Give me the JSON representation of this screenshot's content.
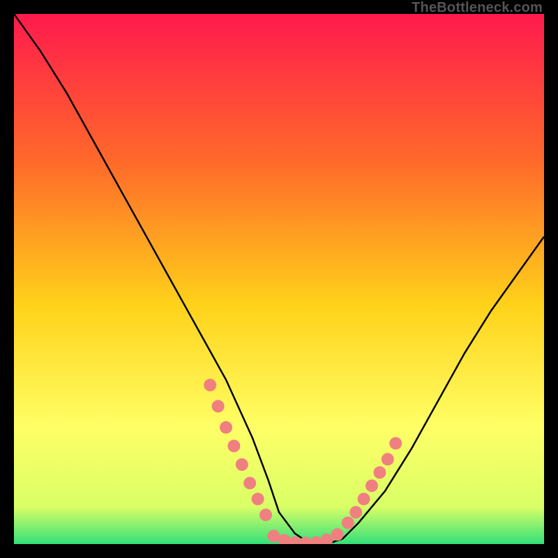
{
  "watermark": "TheBottleneck.com",
  "colors": {
    "frame": "#000000",
    "grad_top": "#ff1a4d",
    "grad_mid1": "#ff6a2a",
    "grad_mid2": "#ffd21a",
    "grad_mid3": "#ffff66",
    "grad_mid4": "#d9ff66",
    "grad_bottom": "#33e07a",
    "curve": "#000000",
    "marker": "#f08080"
  },
  "chart_data": {
    "type": "line",
    "title": "",
    "xlabel": "",
    "ylabel": "",
    "xlim": [
      0,
      100
    ],
    "ylim": [
      0,
      100
    ],
    "series": [
      {
        "name": "bottleneck_curve",
        "x": [
          0,
          5,
          10,
          15,
          20,
          25,
          30,
          35,
          40,
          45,
          48,
          50,
          53,
          56,
          59,
          62,
          65,
          70,
          75,
          80,
          85,
          90,
          95,
          100
        ],
        "y": [
          100,
          93,
          85,
          76,
          67,
          58,
          49,
          40,
          31,
          20,
          12,
          6,
          2,
          0,
          0,
          1,
          4,
          10,
          18,
          27,
          36,
          44,
          51,
          58
        ]
      }
    ],
    "markers_left": {
      "x": [
        37,
        38.5,
        40,
        41.5,
        43,
        44.5,
        46,
        47.5
      ],
      "y": [
        30,
        26,
        22,
        18.5,
        15,
        11.5,
        8.5,
        5.5
      ]
    },
    "markers_bottom": {
      "x": [
        49,
        51,
        53,
        55,
        57,
        59,
        61
      ],
      "y": [
        1.5,
        0.7,
        0.3,
        0.2,
        0.3,
        0.8,
        1.8
      ]
    },
    "markers_right": {
      "x": [
        63,
        64.5,
        66,
        67.5,
        69,
        70.5,
        72
      ],
      "y": [
        4,
        6,
        8.5,
        11,
        13.5,
        16,
        19
      ]
    }
  }
}
